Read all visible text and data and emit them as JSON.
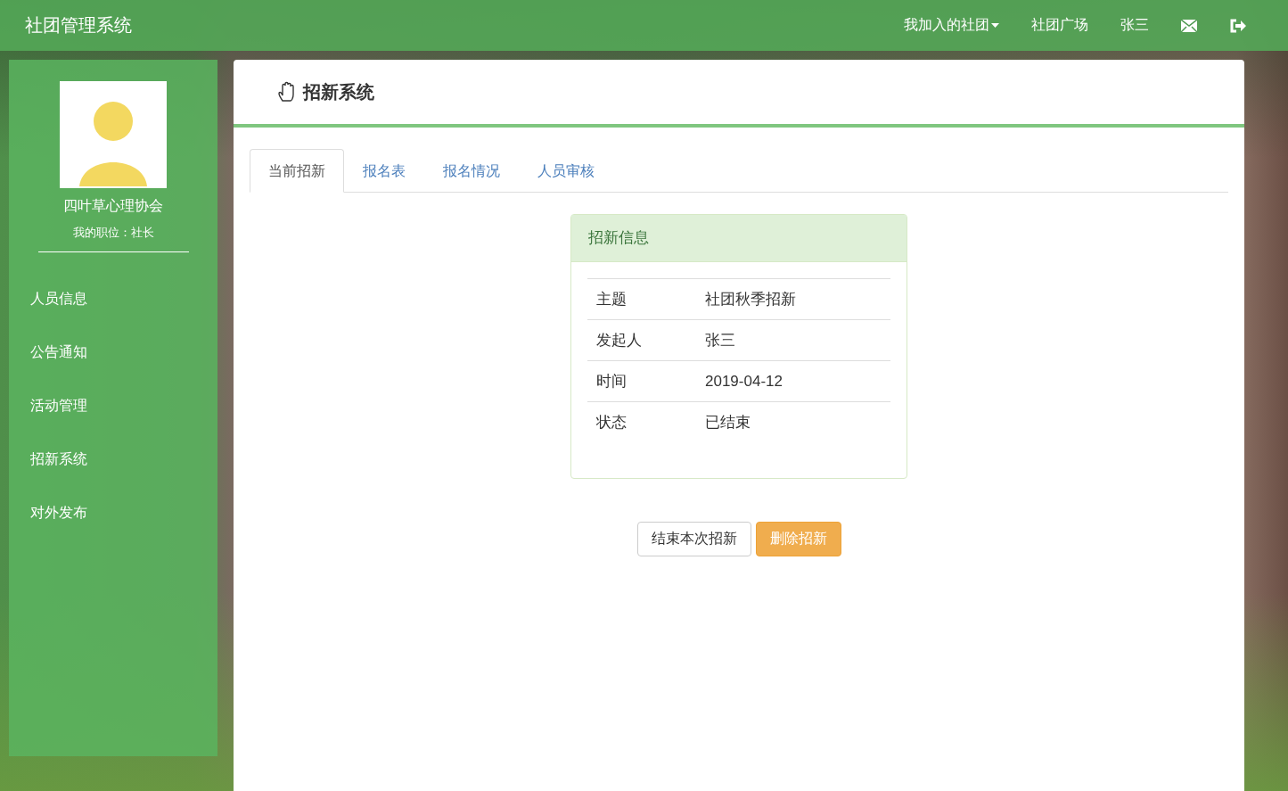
{
  "navbar": {
    "brand": "社团管理系统",
    "links": [
      {
        "label": "我加入的社团",
        "kind": "dropdown"
      },
      {
        "label": "社团广场",
        "kind": "link"
      },
      {
        "label": "张三",
        "kind": "link"
      },
      {
        "kind": "mail"
      },
      {
        "kind": "logout"
      }
    ]
  },
  "sidebar": {
    "club_name": "四叶草心理协会",
    "position": "我的职位：社长",
    "items": [
      {
        "label": "人员信息",
        "selected": false
      },
      {
        "label": "公告通知",
        "selected": false
      },
      {
        "label": "活动管理",
        "selected": false
      },
      {
        "label": "招新系统",
        "selected": false
      },
      {
        "label": "对外发布",
        "selected": false
      }
    ]
  },
  "panel": {
    "title": "招新系统",
    "tabs": [
      {
        "label": "当前招新",
        "selected": true
      },
      {
        "label": "报名表",
        "selected": false
      },
      {
        "label": "报名情况",
        "selected": false
      },
      {
        "label": "人员审核",
        "selected": false
      }
    ],
    "card": {
      "title": "招新信息",
      "rows": [
        {
          "label": "主题",
          "value": "社团秋季招新"
        },
        {
          "label": "发起人",
          "value": "张三"
        },
        {
          "label": "时间",
          "value": "2019-04-12"
        },
        {
          "label": "状态",
          "value": "已结束"
        }
      ]
    },
    "buttons": [
      {
        "label": "结束本次招新",
        "kind": "default"
      },
      {
        "label": "删除招新",
        "kind": "warning"
      }
    ]
  }
}
